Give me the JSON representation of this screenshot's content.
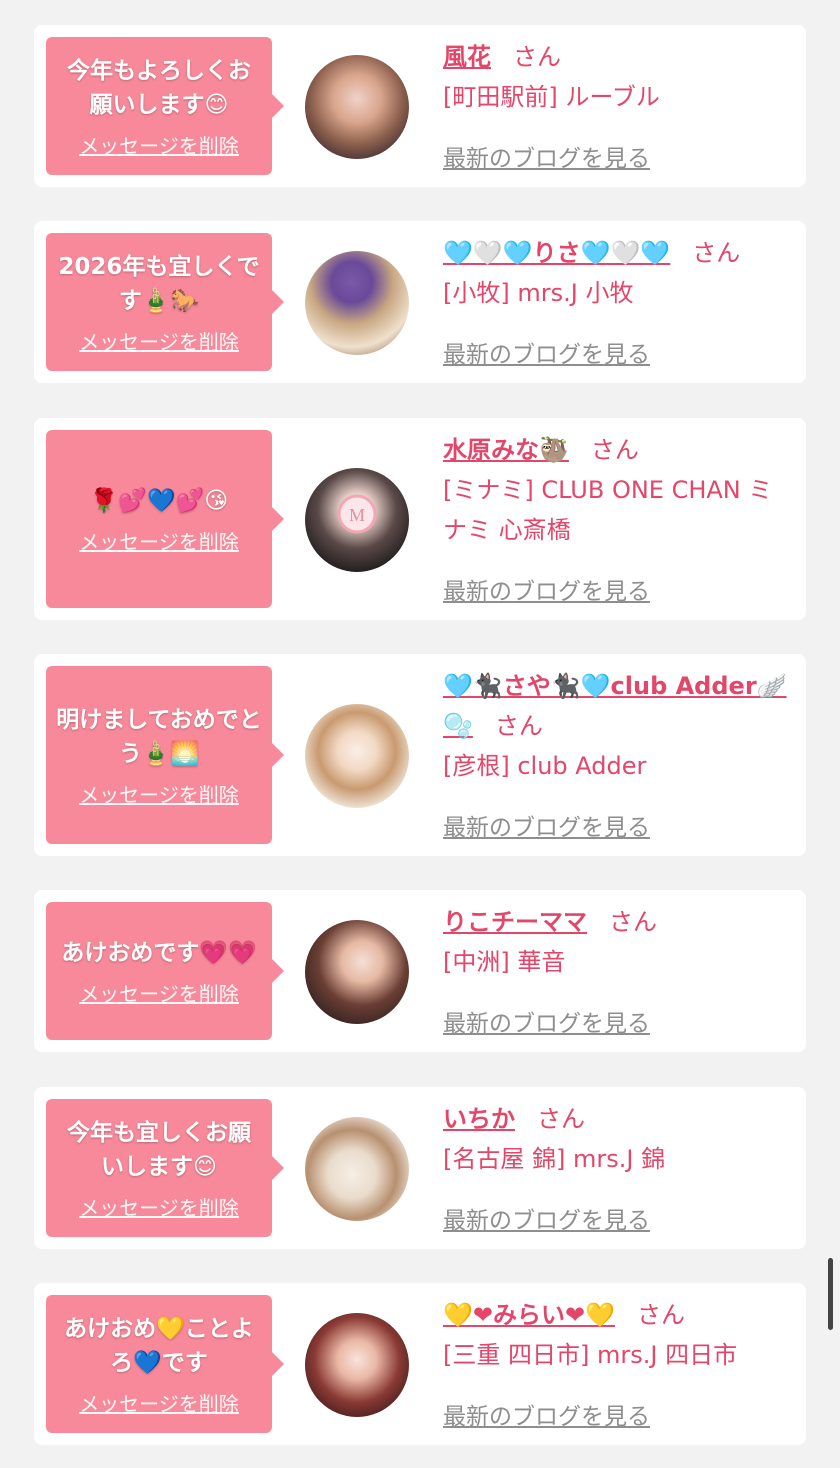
{
  "delete_label": "メッセージを削除",
  "blog_label": "最新のブログを見る",
  "san_label": "さん",
  "colors": {
    "accent": "#e4466a",
    "bubble": "#f8899a",
    "link_gray": "#8e8e8e"
  },
  "items": [
    {
      "message": "今年もよろしくお願いします😊",
      "name": "風花",
      "shop": "[町田駅前] ルーブル"
    },
    {
      "message": "2026年も宜しくです🎍🐎",
      "name": "🩵🤍🩵りさ🩵🤍🩵",
      "shop": "[小牧] mrs.J 小牧"
    },
    {
      "message": "🌹💕💙💕😘",
      "name": "水原みな🦥",
      "shop": "[ミナミ] CLUB ONE CHAN ミナミ 心斎橋"
    },
    {
      "message": "明けましておめでとう🎍🌅",
      "name": "🩵🐈‍⬛さや🐈‍⬛🩵club Adder🪽🫧",
      "shop": "[彦根] club Adder"
    },
    {
      "message": "あけおめです💗💗",
      "name": "りこチーママ",
      "shop": "[中洲] 華音"
    },
    {
      "message": "今年も宜しくお願いします😊",
      "name": "いちか",
      "shop": "[名古屋 錦] mrs.J 錦"
    },
    {
      "message": "あけおめ💛ことよろ💙です",
      "name": "💛❤みらい❤💛",
      "shop": "[三重 四日市] mrs.J 四日市"
    }
  ]
}
